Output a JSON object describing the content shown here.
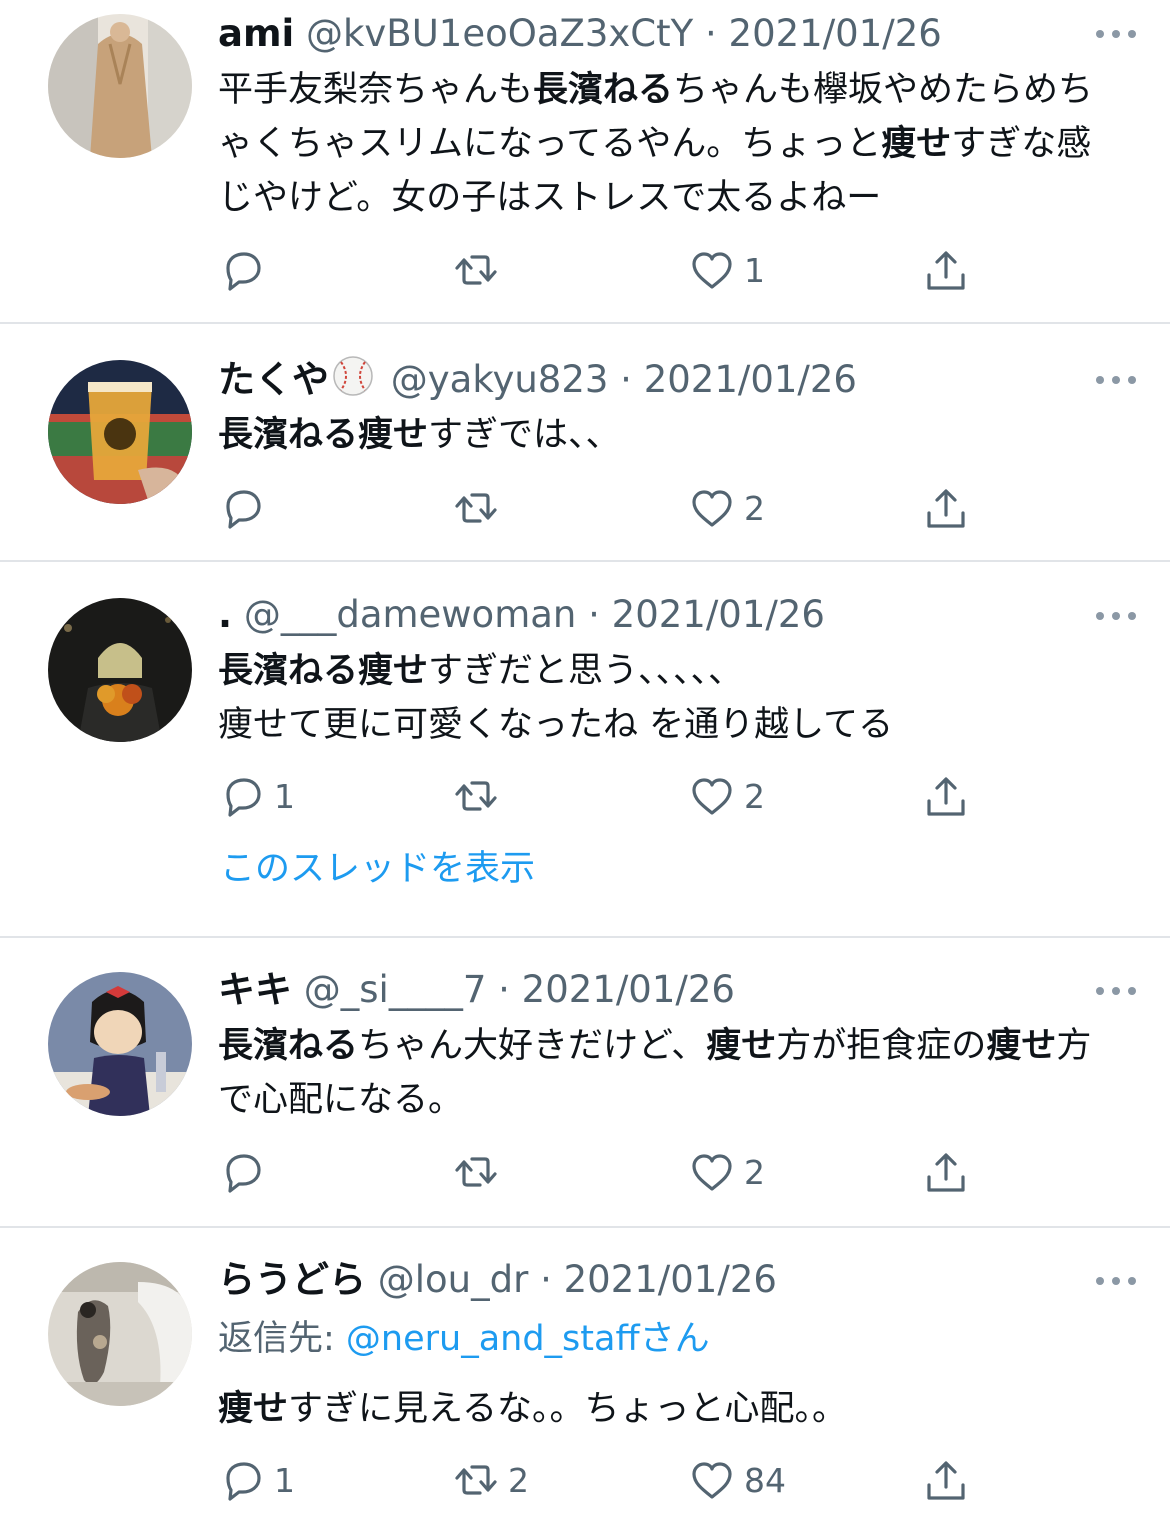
{
  "tweets": [
    {
      "name": "ami",
      "handle": "@kvBU1eoOaZ3xCtY",
      "dot": " · ",
      "date": "2021/01/26",
      "body": [
        {
          "t": "平手友梨奈ちゃんも",
          "b": false
        },
        {
          "t": "長濱ねる",
          "b": true
        },
        {
          "t": "ちゃんも欅坂やめたらめちゃくちゃスリムになってるやん。ちょっと",
          "b": false
        },
        {
          "t": "痩せ",
          "b": true
        },
        {
          "t": "すぎな感じやけど。女の子はストレスで太るよねー",
          "b": false
        }
      ],
      "reply_count": "",
      "retweet_count": "",
      "like_count": "1"
    },
    {
      "name": "たくや",
      "emoji": "baseball-emoji",
      "handle": "@yakyu823",
      "dot": " · ",
      "date": "2021/01/26",
      "body": [
        {
          "t": "長濱ねる痩せ",
          "b": true
        },
        {
          "t": "すぎでは、、",
          "b": false
        }
      ],
      "reply_count": "",
      "retweet_count": "",
      "like_count": "2"
    },
    {
      "name": ".",
      "handle": "@___damewoman",
      "dot": " · ",
      "date": "2021/01/26",
      "body_lines": [
        [
          {
            "t": "長濱ねる痩せ",
            "b": true
          },
          {
            "t": "すぎだと思う、、、、、",
            "b": false
          }
        ],
        [
          {
            "t": "痩せて更に可愛くなったね を通り越してる",
            "b": false
          }
        ]
      ],
      "reply_count": "1",
      "retweet_count": "",
      "like_count": "2",
      "thread_link": "このスレッドを表示"
    },
    {
      "name": "キキ",
      "handle": "@_si____7",
      "dot": " · ",
      "date": "2021/01/26",
      "body": [
        {
          "t": "長濱ねる",
          "b": true
        },
        {
          "t": "ちゃん大好きだけど、",
          "b": false
        },
        {
          "t": "痩せ",
          "b": true
        },
        {
          "t": "方が拒食症の",
          "b": false
        },
        {
          "t": "痩せ",
          "b": true
        },
        {
          "t": "方で心配になる。",
          "b": false
        }
      ],
      "reply_count": "",
      "retweet_count": "",
      "like_count": "2"
    },
    {
      "name": "らうどら",
      "handle": "@lou_dr",
      "dot": " · ",
      "date": "2021/01/26",
      "reply_to_prefix": "返信先: ",
      "reply_to_handle": "@neru_and_staffさん",
      "body": [
        {
          "t": "痩せ",
          "b": true
        },
        {
          "t": "すぎに見えるな。。ちょっと心配。。",
          "b": false
        }
      ],
      "reply_count": "1",
      "retweet_count": "2",
      "like_count": "84"
    }
  ],
  "colors": {
    "text": "#0f1419",
    "meta": "#536471",
    "link": "#1d9bf0",
    "divider": "#e1e4e8"
  },
  "icons": {
    "reply": "reply-icon",
    "retweet": "retweet-icon",
    "like": "heart-icon",
    "share": "share-icon",
    "more": "more-icon"
  }
}
